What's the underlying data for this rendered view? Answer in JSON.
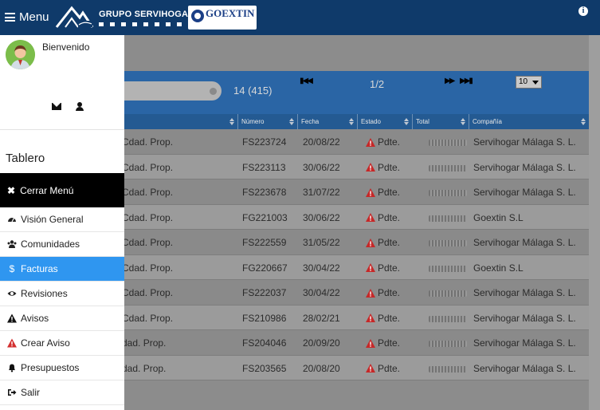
{
  "header": {
    "menu_label": "Menu",
    "brand": "GRUPO SERVIHOGAR",
    "logo_left_icon": "servihogar-house-logo",
    "logo_right_text": "GOEXTIN",
    "info_icon": "i"
  },
  "sidebar": {
    "welcome": "Bienvenido",
    "section_title": "Tablero",
    "close_label": "Cerrar Menú",
    "items": [
      {
        "label": "Visión General",
        "icon": "tachometer-icon"
      },
      {
        "label": "Comunidades",
        "icon": "users-icon"
      },
      {
        "label": "Facturas",
        "icon": "dollar-icon",
        "active": true
      },
      {
        "label": "Revisiones",
        "icon": "eye-icon"
      },
      {
        "label": "Avisos",
        "icon": "warning-icon"
      },
      {
        "label": "Crear Aviso",
        "icon": "warning-red-icon"
      },
      {
        "label": "Presupuestos",
        "icon": "bell-icon"
      },
      {
        "label": "Salir",
        "icon": "sign-out-icon"
      }
    ]
  },
  "toolbar": {
    "count": "14 (415)",
    "page": "1/2",
    "per_page": "10"
  },
  "table": {
    "columns": [
      "Número",
      "Fecha",
      "Estado",
      "Total",
      "Compañía"
    ],
    "rows": [
      {
        "tipo": "Cdad. Prop.",
        "numero": "FS223724",
        "fecha": "20/08/22",
        "estado": "Pdte.",
        "compania": "Servihogar Málaga S. L."
      },
      {
        "tipo": "Cdad. Prop.",
        "numero": "FS223113",
        "fecha": "30/06/22",
        "estado": "Pdte.",
        "compania": "Servihogar Málaga S. L."
      },
      {
        "tipo": "Cdad. Prop.",
        "numero": "FS223678",
        "fecha": "31/07/22",
        "estado": "Pdte.",
        "compania": "Servihogar Málaga S. L."
      },
      {
        "tipo": "Cdad. Prop.",
        "numero": "FG221003",
        "fecha": "30/06/22",
        "estado": "Pdte.",
        "compania": "Goextin S.L"
      },
      {
        "tipo": "Cdad. Prop.",
        "numero": "FS222559",
        "fecha": "31/05/22",
        "estado": "Pdte.",
        "compania": "Servihogar Málaga S. L."
      },
      {
        "tipo": "Cdad. Prop.",
        "numero": "FG220667",
        "fecha": "30/04/22",
        "estado": "Pdte.",
        "compania": "Goextin S.L"
      },
      {
        "tipo": "Cdad. Prop.",
        "numero": "FS222037",
        "fecha": "30/04/22",
        "estado": "Pdte.",
        "compania": "Servihogar Málaga S. L."
      },
      {
        "tipo": "Cdad. Prop.",
        "numero": "FS210986",
        "fecha": "28/02/21",
        "estado": "Pdte.",
        "compania": "Servihogar Málaga S. L."
      },
      {
        "tipo": "dad. Prop.",
        "numero": "FS204046",
        "fecha": "20/09/20",
        "estado": "Pdte.",
        "compania": "Servihogar Málaga S. L."
      },
      {
        "tipo": "dad. Prop.",
        "numero": "FS203565",
        "fecha": "20/08/20",
        "estado": "Pdte.",
        "compania": "Servihogar Málaga S. L."
      }
    ]
  },
  "colors": {
    "header": "#0f3a6a",
    "toolbar": "#2a65a5",
    "active_item": "#2f96f0",
    "warning_red": "#d32f2f"
  }
}
